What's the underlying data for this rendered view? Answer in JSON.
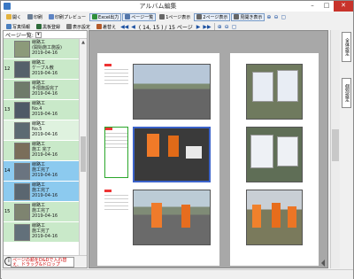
{
  "window": {
    "title": "アルバム編集"
  },
  "toolbar1": [
    {
      "label": "開く",
      "icon": "folder-icon",
      "color": "#e3b23c"
    },
    {
      "label": "印刷",
      "icon": "printer-icon",
      "color": "#6a7d94"
    },
    {
      "label": "印刷プレビュー",
      "icon": "preview-icon",
      "color": "#5e84c4"
    },
    {
      "label": "Excel出力",
      "icon": "excel-icon",
      "color": "#2f8f3a",
      "boxed": true
    },
    {
      "label": "ページ一覧",
      "icon": "list-icon",
      "color": "#5577aa",
      "boxed": true
    },
    {
      "label": "1ページ表示",
      "icon": "one-page-icon",
      "color": "#666"
    },
    {
      "label": "2ページ表示",
      "icon": "two-page-icon",
      "color": "#666",
      "boxed": true
    },
    {
      "label": "見開き表示",
      "icon": "spread-icon",
      "color": "#666",
      "boxed": true
    }
  ],
  "toolbar2": {
    "items": [
      {
        "label": "写真情報",
        "icon": "photo-info-icon",
        "color": "#4a7fbf"
      },
      {
        "label": "黒板登録",
        "icon": "board-icon",
        "color": "#2e6b3a"
      },
      {
        "label": "表示設定",
        "icon": "display-settings-icon",
        "color": "#7a7a7a"
      },
      {
        "label": "差替え",
        "icon": "replace-icon",
        "color": "#b55a2a"
      }
    ],
    "page_indicator": "( 14, 15 ) / 15 ページ"
  },
  "left_panel": {
    "header": "ページ一覧:",
    "rows": [
      {
        "num": "",
        "text": [
          "線路工",
          "(開始施工施設)",
          "2019-04-16"
        ],
        "style": ""
      },
      {
        "num": "12",
        "text": [
          "線路工",
          "ケーブル敷",
          "2019-04-16"
        ],
        "style": ""
      },
      {
        "num": "",
        "text": [
          "線路工",
          "手摺施設完了",
          "2019-04-16"
        ],
        "style": ""
      },
      {
        "num": "13",
        "text": [
          "線路工",
          "No.4",
          "2019-04-16"
        ],
        "style": ""
      },
      {
        "num": "",
        "text": [
          "線路工",
          "No.5",
          "2019-04-16"
        ],
        "style": "alt"
      },
      {
        "num": "",
        "text": [
          "線路工",
          "施工 完了",
          "2019-04-16"
        ],
        "style": ""
      },
      {
        "num": "14",
        "text": [
          "線路工",
          "施工完了",
          "2019-04-16"
        ],
        "style": "blue"
      },
      {
        "num": "",
        "text": [
          "線路工",
          "施工完了",
          "2019-04-16"
        ],
        "style": "blue"
      },
      {
        "num": "15",
        "text": [
          "線路工",
          "施工完了",
          "2019-04-16"
        ],
        "style": ""
      },
      {
        "num": "",
        "text": [
          "線路工",
          "施工完了",
          "2019-04-16"
        ],
        "style": ""
      }
    ],
    "footer_hint": "ページの順をD&Dで入れ替え、ドラッグ&ドロップ",
    "footer_circle": "i"
  },
  "side_tabs": {
    "tab1": "全体設定",
    "tab2": "個別設定"
  }
}
